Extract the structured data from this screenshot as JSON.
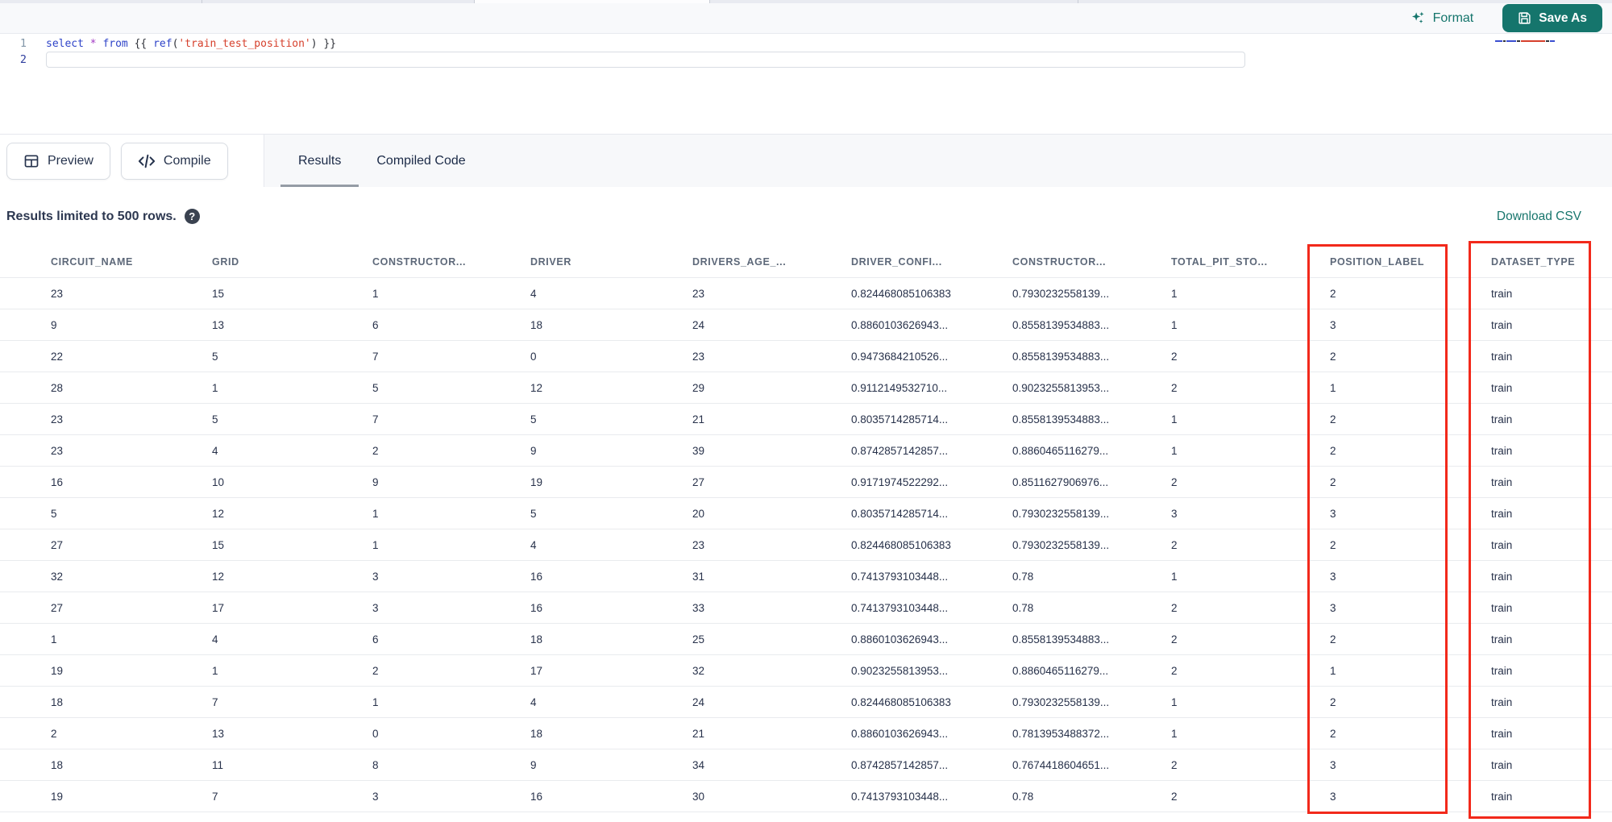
{
  "toolbar": {
    "format_label": "Format",
    "save_as_label": "Save As"
  },
  "editor": {
    "lines": [
      {
        "number": "1",
        "tokens": [
          {
            "t": "select",
            "c": "kw"
          },
          {
            "t": " ",
            "c": "pl"
          },
          {
            "t": "*",
            "c": "op"
          },
          {
            "t": " ",
            "c": "pl"
          },
          {
            "t": "from",
            "c": "kw"
          },
          {
            "t": " {{ ",
            "c": "pl"
          },
          {
            "t": "ref",
            "c": "fn"
          },
          {
            "t": "(",
            "c": "pl"
          },
          {
            "t": "'train_test_position'",
            "c": "str"
          },
          {
            "t": ") }}",
            "c": "pl"
          }
        ]
      },
      {
        "number": "2",
        "tokens": []
      }
    ]
  },
  "actions": {
    "preview_label": "Preview",
    "compile_label": "Compile"
  },
  "tabs": [
    {
      "label": "Results",
      "active": true
    },
    {
      "label": "Compiled Code",
      "active": false
    }
  ],
  "results_bar": {
    "limit_text": "Results limited to 500 rows.",
    "help_icon": "?",
    "download_label": "Download CSV"
  },
  "table": {
    "columns": [
      "CIRCUIT_NAME",
      "GRID",
      "CONSTRUCTOR...",
      "DRIVER",
      "DRIVERS_AGE_...",
      "DRIVER_CONFI...",
      "CONSTRUCTOR...",
      "TOTAL_PIT_STO...",
      "POSITION_LABEL",
      "DATASET_TYPE"
    ],
    "rows": [
      [
        "23",
        "15",
        "1",
        "4",
        "23",
        "0.824468085106383",
        "0.7930232558139...",
        "1",
        "2",
        "train"
      ],
      [
        "9",
        "13",
        "6",
        "18",
        "24",
        "0.8860103626943...",
        "0.8558139534883...",
        "1",
        "3",
        "train"
      ],
      [
        "22",
        "5",
        "7",
        "0",
        "23",
        "0.9473684210526...",
        "0.8558139534883...",
        "2",
        "2",
        "train"
      ],
      [
        "28",
        "1",
        "5",
        "12",
        "29",
        "0.9112149532710...",
        "0.9023255813953...",
        "2",
        "1",
        "train"
      ],
      [
        "23",
        "5",
        "7",
        "5",
        "21",
        "0.8035714285714...",
        "0.8558139534883...",
        "1",
        "2",
        "train"
      ],
      [
        "23",
        "4",
        "2",
        "9",
        "39",
        "0.8742857142857...",
        "0.8860465116279...",
        "1",
        "2",
        "train"
      ],
      [
        "16",
        "10",
        "9",
        "19",
        "27",
        "0.9171974522292...",
        "0.8511627906976...",
        "2",
        "2",
        "train"
      ],
      [
        "5",
        "12",
        "1",
        "5",
        "20",
        "0.8035714285714...",
        "0.7930232558139...",
        "3",
        "3",
        "train"
      ],
      [
        "27",
        "15",
        "1",
        "4",
        "23",
        "0.824468085106383",
        "0.7930232558139...",
        "2",
        "2",
        "train"
      ],
      [
        "32",
        "12",
        "3",
        "16",
        "31",
        "0.7413793103448...",
        "0.78",
        "1",
        "3",
        "train"
      ],
      [
        "27",
        "17",
        "3",
        "16",
        "33",
        "0.7413793103448...",
        "0.78",
        "2",
        "3",
        "train"
      ],
      [
        "1",
        "4",
        "6",
        "18",
        "25",
        "0.8860103626943...",
        "0.8558139534883...",
        "2",
        "2",
        "train"
      ],
      [
        "19",
        "1",
        "2",
        "17",
        "32",
        "0.9023255813953...",
        "0.8860465116279...",
        "2",
        "1",
        "train"
      ],
      [
        "18",
        "7",
        "1",
        "4",
        "24",
        "0.824468085106383",
        "0.7930232558139...",
        "1",
        "2",
        "train"
      ],
      [
        "2",
        "13",
        "0",
        "18",
        "21",
        "0.8860103626943...",
        "0.7813953488372...",
        "1",
        "2",
        "train"
      ],
      [
        "18",
        "11",
        "8",
        "9",
        "34",
        "0.8742857142857...",
        "0.7674418604651...",
        "2",
        "3",
        "train"
      ],
      [
        "19",
        "7",
        "3",
        "16",
        "30",
        "0.7413793103448...",
        "0.78",
        "2",
        "3",
        "train"
      ]
    ]
  },
  "annotations": [
    {
      "column": "POSITION_LABEL"
    },
    {
      "column": "DATASET_TYPE"
    }
  ],
  "colors": {
    "accent_teal": "#15756c",
    "annotation_red": "#f2291b",
    "keyword_blue": "#2e43c8",
    "string_red": "#d6402c",
    "operator_purple": "#a23bc4"
  }
}
